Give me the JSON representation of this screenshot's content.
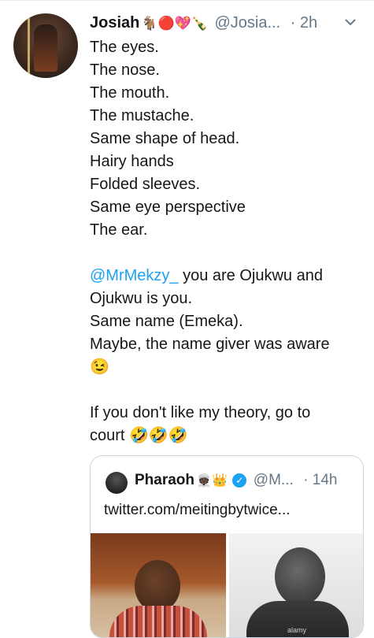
{
  "tweet": {
    "author_name": "Josiah",
    "author_emojis": "🐐🔴💖🍾",
    "handle": "@Josia...",
    "time": "· 2h",
    "lines": [
      "The eyes.",
      "The nose.",
      "The mouth.",
      "The mustache.",
      "Same shape of head.",
      "Hairy hands",
      "Folded sleeves.",
      "Same eye perspective",
      "The ear.",
      "",
      "",
      "Ojukwu is you.",
      "Same name (Emeka).",
      "Maybe, the name giver was aware",
      "😉",
      "",
      "If you don't like my theory, go to",
      "court 🤣🤣🤣"
    ],
    "mention": "@MrMekzy_",
    "mention_rest": " you are Ojukwu and"
  },
  "quoted_tweet": {
    "name": "Pharaoh",
    "emojis": "👳🏿👑",
    "verified_mark": "✓",
    "handle": "@M...",
    "time": "· 14h",
    "text": "twitter.com/meitingbytwice...",
    "watermark": "alamy"
  },
  "icons": {
    "caret": "chevron-down-icon"
  }
}
